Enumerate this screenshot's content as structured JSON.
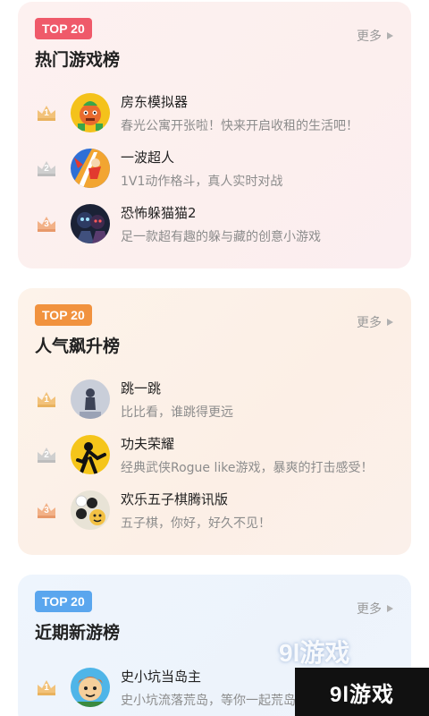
{
  "sections": [
    {
      "badge": "TOP 20",
      "badge_color": "#ef5a6a",
      "title": "热门游戏榜",
      "more_label": "更多",
      "items": [
        {
          "rank": "1",
          "name": "房东模拟器",
          "desc": "春光公寓开张啦！快来开启收租的生活吧！",
          "icon": "landlord-game-icon"
        },
        {
          "rank": "2",
          "name": "一波超人",
          "desc": "1V1动作格斗，真人实时对战",
          "icon": "superhero-game-icon"
        },
        {
          "rank": "3",
          "name": "恐怖躲猫猫2",
          "desc": "足一款超有趣的躲与藏的创意小游戏",
          "icon": "horror-hide-game-icon"
        }
      ]
    },
    {
      "badge": "TOP 20",
      "badge_color": "#f1923e",
      "title": "人气飙升榜",
      "more_label": "更多",
      "items": [
        {
          "rank": "1",
          "name": "跳一跳",
          "desc": "比比看，谁跳得更远",
          "icon": "jump-game-icon"
        },
        {
          "rank": "2",
          "name": "功夫荣耀",
          "desc": "经典武侠Rogue like游戏，暴爽的打击感受！",
          "icon": "kungfu-game-icon"
        },
        {
          "rank": "3",
          "name": "欢乐五子棋腾讯版",
          "desc": "五子棋，你好，好久不见！",
          "icon": "gomoku-game-icon"
        }
      ]
    },
    {
      "badge": "TOP 20",
      "badge_color": "#5aa6ee",
      "title": "近期新游榜",
      "more_label": "更多",
      "items": [
        {
          "rank": "1",
          "name": "史小坑当岛主",
          "desc": "史小坑流落荒岛，等你一起荒岛",
          "icon": "island-game-icon"
        }
      ]
    }
  ],
  "watermark": {
    "text": "9l游戏",
    "faint_text": "9l游戏"
  }
}
